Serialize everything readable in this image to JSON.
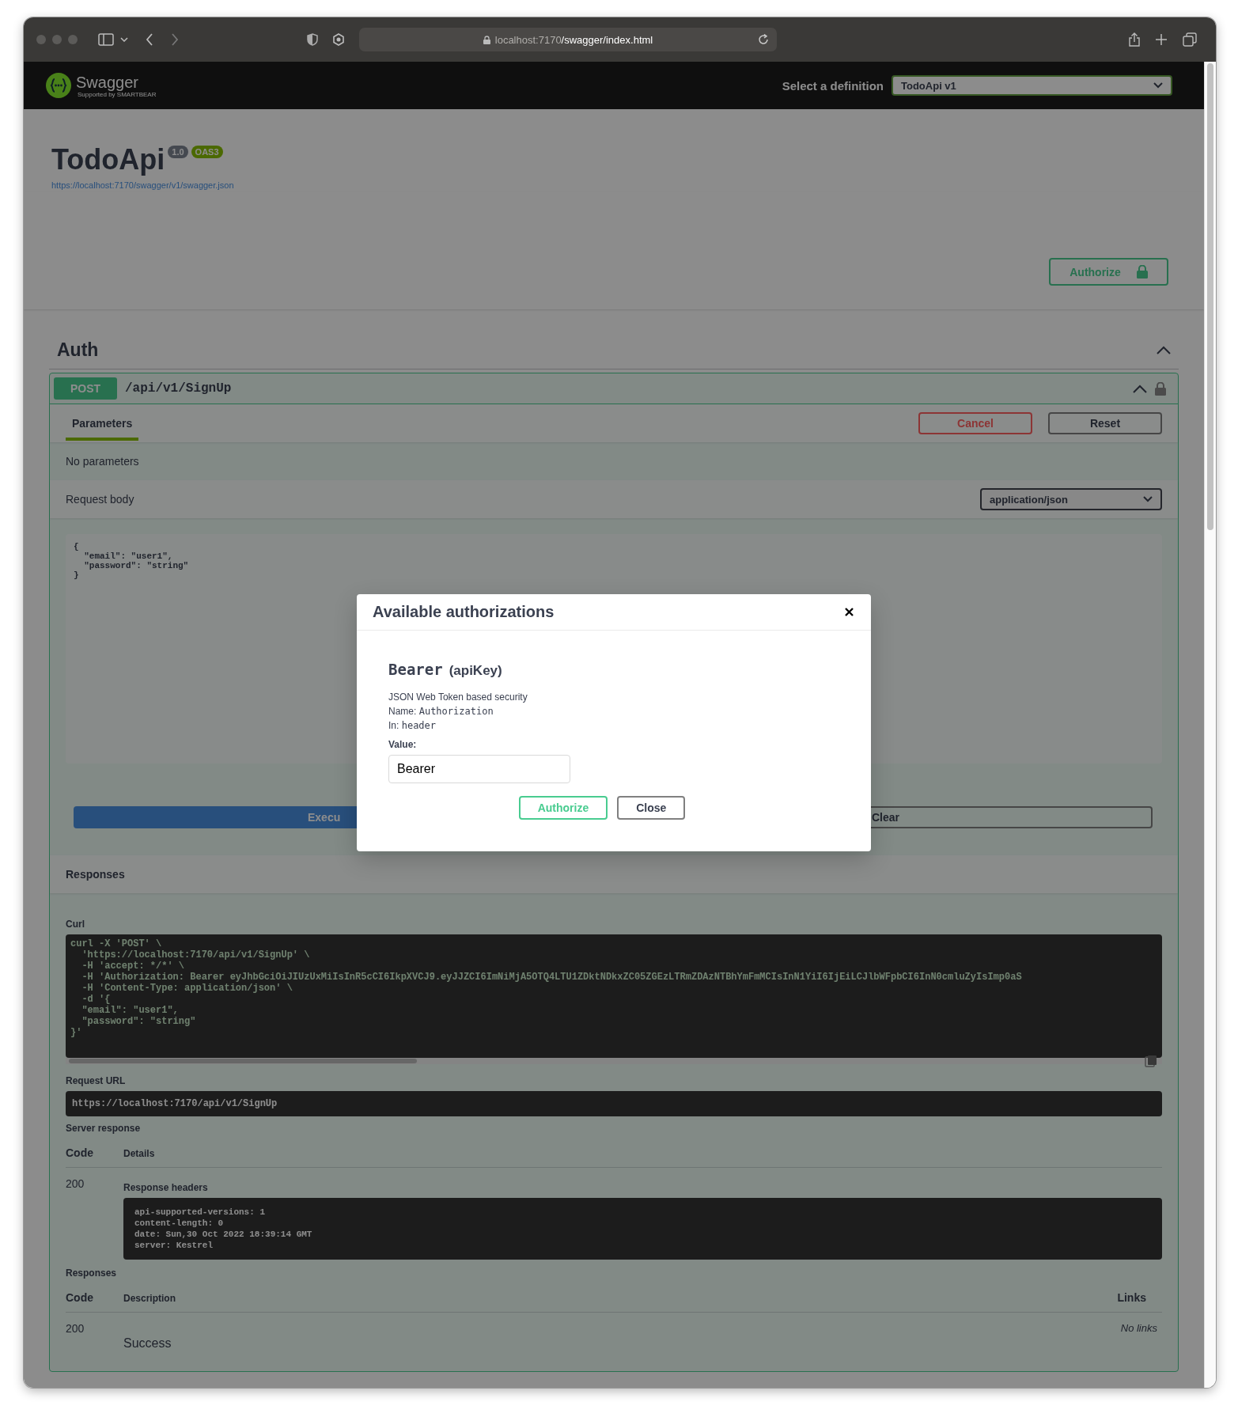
{
  "browser": {
    "url_host": "localhost:7170",
    "url_path": "/swagger/index.html"
  },
  "topbar": {
    "logo_text": "Swagger",
    "logo_subtext": "Supported by SMARTBEAR",
    "definition_label": "Select a definition",
    "definition_value": "TodoApi v1"
  },
  "info": {
    "title": "TodoApi",
    "version": "1.0",
    "spec_badge": "OAS3",
    "spec_url": "https://localhost:7170/swagger/v1/swagger.json"
  },
  "authorize_button": {
    "label": "Authorize"
  },
  "tags": [
    {
      "name": "Auth",
      "expanded": true,
      "operation": {
        "method": "POST",
        "path": "/api/v1/SignUp",
        "expanded": true,
        "tabs": [
          {
            "label": "Parameters",
            "selected": true
          }
        ],
        "cancel": "Cancel",
        "reset": "Reset",
        "no_params": "No parameters",
        "request_body_label": "Request body",
        "content_type": "application/json",
        "body_example": "{\n  \"email\": \"user1\",\n  \"password\": \"string\"\n}",
        "execute": "Execu",
        "clear": "Clear",
        "responses_title": "Responses",
        "curl_label": "Curl",
        "curl_lines": [
          "curl -X 'POST' \\",
          "  'https://localhost:7170/api/v1/SignUp' \\",
          "  -H 'accept: */*' \\",
          "  -H 'Authorization: Bearer eyJhbGciOiJIUzUxMiIsInR5cCI6IkpXVCJ9.eyJJZCI6ImNiMjA5OTQ4LTU1ZDktNDkxZC05ZGEzLTRmZDAzNTBhYmFmMCIsInN1YiI6IjEiLCJlbWFpbCI6InN0cmluZyIsImp0aS",
          "  -H 'Content-Type: application/json' \\",
          "  -d '{",
          "  \"email\": \"user1\",",
          "  \"password\": \"string\"",
          "}'"
        ],
        "request_url_label": "Request URL",
        "request_url": "https://localhost:7170/api/v1/SignUp",
        "server_response_label": "Server response",
        "server_columns": [
          "Code",
          "Details"
        ],
        "server_row": {
          "code": "200",
          "headers_label": "Response headers",
          "headers": [
            "api-supported-versions: 1",
            "content-length: 0",
            "date: Sun,30 Oct 2022 18:39:14 GMT",
            "server: Kestrel"
          ]
        },
        "responses_label": "Responses",
        "response_columns": [
          "Code",
          "Description",
          "Links"
        ],
        "response_row": {
          "code": "200",
          "description": "Success",
          "links": "No links"
        }
      }
    }
  ],
  "modal": {
    "title": "Available authorizations",
    "scheme_name": "Bearer",
    "scheme_type": "(apiKey)",
    "description": "JSON Web Token based security",
    "name_label": "Name:",
    "name_value": "Authorization",
    "in_label": "In:",
    "in_value": "header",
    "value_label": "Value:",
    "value": "Bearer",
    "buttons": [
      {
        "kind": "primary",
        "label": "Authorize"
      },
      {
        "kind": "secondary",
        "label": "Close"
      }
    ]
  }
}
